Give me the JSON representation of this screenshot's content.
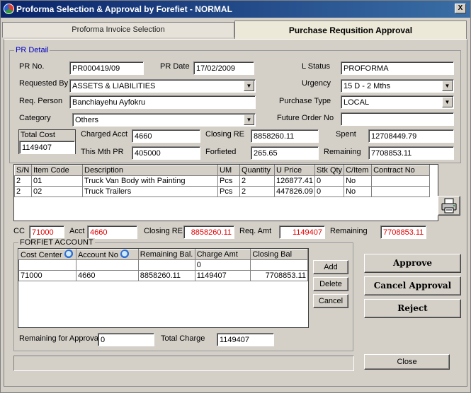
{
  "window": {
    "title": "Proforma Selection & Approval by Forefiet - NORMAL",
    "close": "X"
  },
  "tabs": [
    {
      "label": "Proforma Invoice Selection"
    },
    {
      "label": "Purchase Requsition Approval"
    }
  ],
  "pr_detail": {
    "legend": "PR Detail",
    "pr_no": {
      "label": "PR No.",
      "value": "PR000419/09"
    },
    "pr_date": {
      "label": "PR Date",
      "value": "17/02/2009"
    },
    "l_status": {
      "label": "L Status",
      "value": "PROFORMA"
    },
    "requested_by": {
      "label": "Requested By",
      "value": "ASSETS & LIABILITIES"
    },
    "urgency": {
      "label": "Urgency",
      "value": "15 D - 2 Mths"
    },
    "req_person": {
      "label": "Req. Person",
      "value": "Banchiayehu Ayfokru"
    },
    "purchase_type": {
      "label": "Purchase Type",
      "value": "LOCAL"
    },
    "category": {
      "label": "Category",
      "value": "Others"
    },
    "future_order_no": {
      "label": "Future Order No",
      "value": ""
    },
    "total_cost": {
      "label": "Total Cost",
      "value": "1149407"
    },
    "charged_acct": {
      "label": "Charged Acct",
      "value": "4660"
    },
    "closing_re": {
      "label": "Closing RE",
      "value": "8858260.11"
    },
    "spent": {
      "label": "Spent",
      "value": "12708449.79"
    },
    "this_mth_pr": {
      "label": "This Mth PR",
      "value": "405000"
    },
    "forfieted": {
      "label": "Forfieted",
      "value": "265.65"
    },
    "remaining": {
      "label": "Remaining",
      "value": "7708853.11"
    }
  },
  "items_table": {
    "columns": [
      "S/N",
      "Item Code",
      "Description",
      "UM",
      "Quantity",
      "U Price",
      "Stk Qty",
      "C/Item",
      "Contract No"
    ],
    "rows": [
      [
        "2",
        "01",
        "Truck Van Body with Painting",
        "Pcs",
        "2",
        "126877.41",
        "0",
        "No",
        ""
      ],
      [
        "2",
        "02",
        "Truck Trailers",
        "Pcs",
        "2",
        "447826.09",
        "0",
        "No",
        ""
      ]
    ]
  },
  "summary": {
    "cc": {
      "label": "CC",
      "value": "71000"
    },
    "acct": {
      "label": "Acct",
      "value": "4660"
    },
    "closing_re": {
      "label": "Closing RE",
      "value": "8858260.11"
    },
    "req_amt": {
      "label": "Req. Amt",
      "value": "1149407"
    },
    "remaining": {
      "label": "Remaining",
      "value": "7708853.11"
    }
  },
  "forfiet": {
    "legend": "FORFIET ACCOUNT",
    "columns": [
      "Cost Center",
      "Account No",
      "Remaining Bal.",
      "Charge Amt",
      "Closing Bal"
    ],
    "entry_row": [
      "",
      "",
      "",
      "0",
      ""
    ],
    "rows": [
      [
        "71000",
        "4660",
        "8858260.11",
        "1149407",
        "7708853.11"
      ]
    ],
    "buttons": {
      "add": "Add",
      "delete": "Delete",
      "cancel": "Cancel"
    },
    "remaining_for_approval": {
      "label": "Remaining for Approval",
      "value": "0"
    },
    "total_charge": {
      "label": "Total Charge",
      "value": "1149407"
    }
  },
  "actions": {
    "approve": "Approve",
    "cancel_approval": "Cancel Approval",
    "reject": "Reject",
    "close": "Close"
  },
  "icons": {
    "app": "app-icon",
    "print": "printer-icon",
    "lookup": "magnifier-icon"
  },
  "colors": {
    "title_bar": "#0a246a",
    "legend_blue": "#0000c0",
    "highlight_red": "#e00000"
  }
}
